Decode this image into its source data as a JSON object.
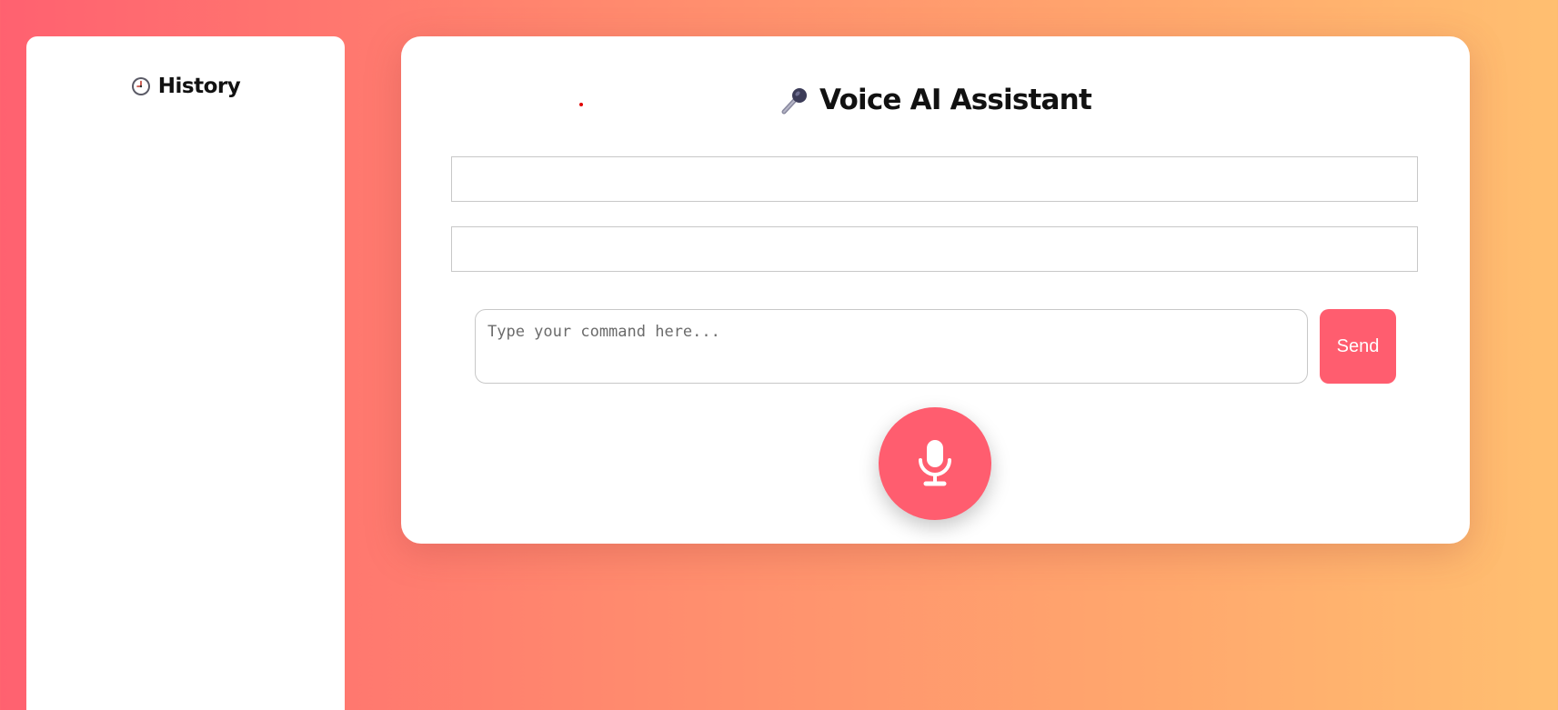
{
  "sidebar": {
    "title": "History",
    "icon": "clock-icon",
    "items": []
  },
  "main": {
    "title": "Voice AI Assistant",
    "title_icon": "microphone-emoji-icon",
    "output_lines": [
      "",
      ""
    ],
    "command": {
      "value": "",
      "placeholder": "Type your command here..."
    },
    "send_label": "Send",
    "mic_icon": "microphone-icon"
  },
  "colors": {
    "accent": "#ff5d6f",
    "gradient_start": "#ff6170",
    "gradient_end": "#ffbf70"
  }
}
